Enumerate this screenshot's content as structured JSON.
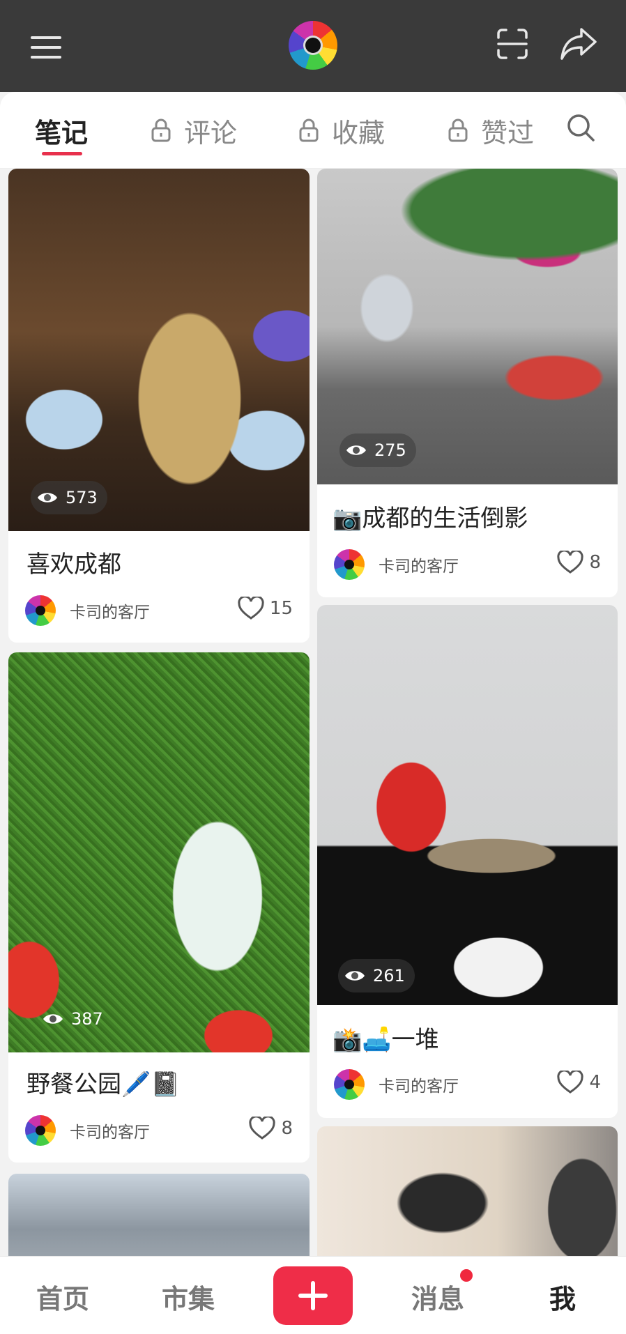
{
  "header": {
    "menu_icon": "menu-icon",
    "avatar_icon": "avatar-icon",
    "scan_icon": "scan-icon",
    "share_icon": "share-icon"
  },
  "tabs": [
    {
      "label": "笔记",
      "locked": false,
      "active": true
    },
    {
      "label": "评论",
      "locked": true,
      "active": false
    },
    {
      "label": "收藏",
      "locked": true,
      "active": false
    },
    {
      "label": "赞过",
      "locked": true,
      "active": false
    }
  ],
  "accent_color": "#e8304c",
  "feed": [
    {
      "views": "573",
      "title": "喜欢成都",
      "author": "卡司的客厅",
      "likes": "15"
    },
    {
      "views": "275",
      "title": "📷成都的生活倒影",
      "author": "卡司的客厅",
      "likes": "8"
    },
    {
      "views": "387",
      "title": "野餐公园🖊️📓",
      "author": "卡司的客厅",
      "likes": "8"
    },
    {
      "views": "261",
      "title": "📸🛋️一堆",
      "author": "卡司的客厅",
      "likes": "4"
    }
  ],
  "bottom_nav": {
    "home": "首页",
    "market": "市集",
    "messages": "消息",
    "me": "我"
  }
}
